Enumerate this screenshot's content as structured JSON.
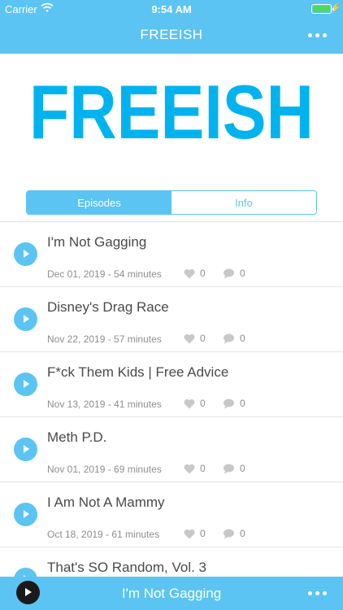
{
  "status_bar": {
    "carrier": "Carrier",
    "time": "9:54 AM"
  },
  "nav": {
    "title": "FREEISH"
  },
  "hero": {
    "logo_text": "FREEISH"
  },
  "tabs": [
    {
      "label": "Episodes",
      "active": true
    },
    {
      "label": "Info",
      "active": false
    }
  ],
  "episodes": [
    {
      "title": "I'm Not Gagging",
      "meta": "Dec 01, 2019 - 54 minutes",
      "likes": "0",
      "comments": "0"
    },
    {
      "title": "Disney's Drag Race",
      "meta": "Nov 22, 2019 - 57 minutes",
      "likes": "0",
      "comments": "0"
    },
    {
      "title": "F*ck Them Kids | Free Advice",
      "meta": "Nov 13, 2019 - 41 minutes",
      "likes": "0",
      "comments": "0"
    },
    {
      "title": "Meth P.D.",
      "meta": "Nov 01, 2019 - 69 minutes",
      "likes": "0",
      "comments": "0"
    },
    {
      "title": "I Am Not A Mammy",
      "meta": "Oct 18, 2019 - 61 minutes",
      "likes": "0",
      "comments": "0"
    },
    {
      "title": "That's SO Random, Vol. 3",
      "meta": "",
      "likes": "",
      "comments": ""
    }
  ],
  "player": {
    "now_playing": "I'm Not Gagging"
  },
  "colors": {
    "accent": "#5bc4f2",
    "logo": "#00b3ee",
    "text": "#4a4a4a",
    "meta": "#8e8e8e"
  }
}
